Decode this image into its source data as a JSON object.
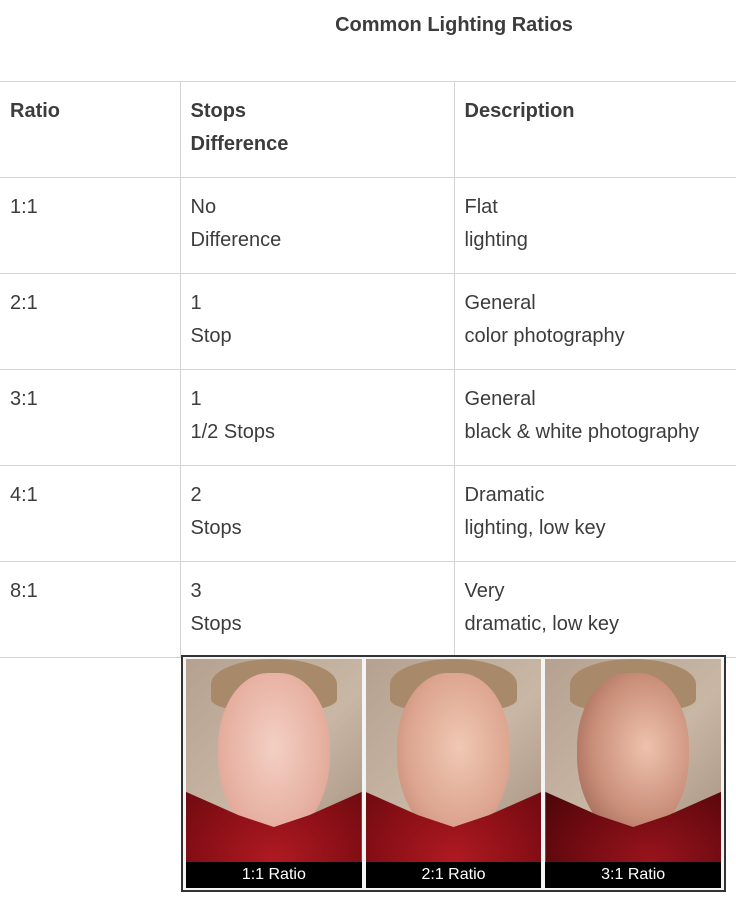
{
  "title": "Common Lighting Ratios",
  "table": {
    "headers": [
      {
        "line1": "Ratio",
        "line2": ""
      },
      {
        "line1": "Stops",
        "line2": "Difference"
      },
      {
        "line1": "Description",
        "line2": ""
      }
    ],
    "rows": [
      {
        "ratio": "1:1",
        "stops1": "No",
        "stops2": "Difference",
        "desc1": "Flat",
        "desc2": "lighting"
      },
      {
        "ratio": "2:1",
        "stops1": "1",
        "stops2": "Stop",
        "desc1": "General",
        "desc2": "color photography"
      },
      {
        "ratio": "3:1",
        "stops1": "1",
        "stops2": "1/2 Stops",
        "desc1": "General",
        "desc2": "black & white photography"
      },
      {
        "ratio": "4:1",
        "stops1": "2",
        "stops2": "Stops",
        "desc1": "Dramatic",
        "desc2": "lighting, low key"
      },
      {
        "ratio": "8:1",
        "stops1": "3",
        "stops2": "Stops",
        "desc1": "Very",
        "desc2": "dramatic, low key"
      }
    ]
  },
  "photos": [
    {
      "caption": "1:1 Ratio"
    },
    {
      "caption": "2:1 Ratio"
    },
    {
      "caption": "3:1 Ratio"
    }
  ]
}
